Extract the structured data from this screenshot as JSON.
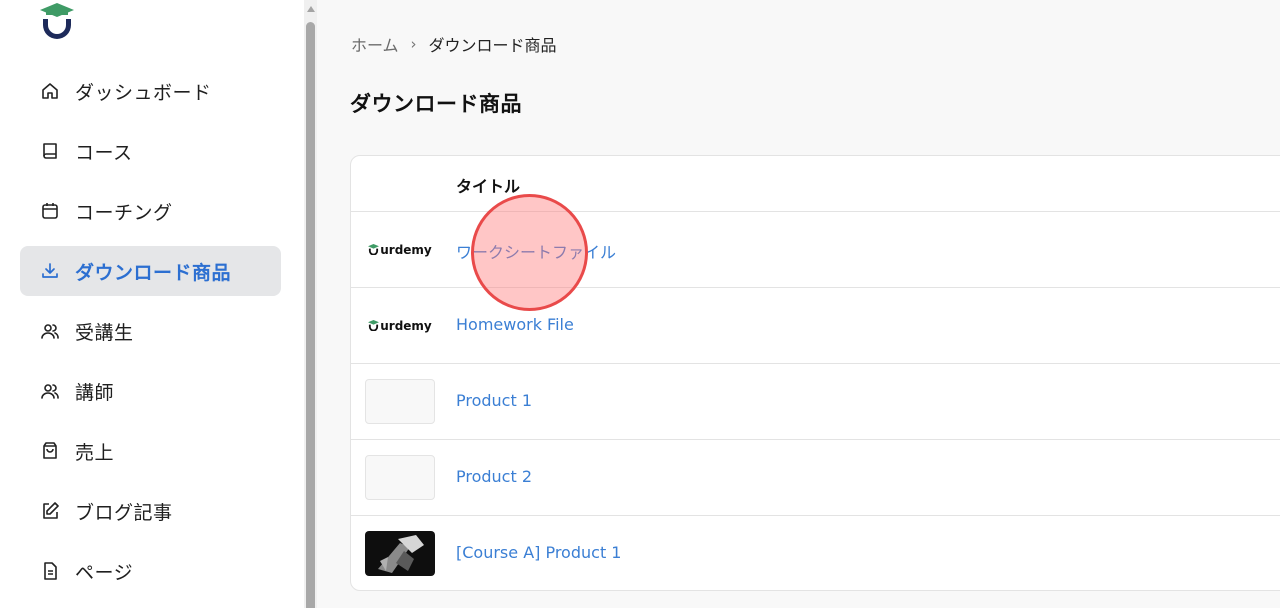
{
  "sidebar": {
    "items": [
      {
        "label": "ダッシュボード",
        "icon": "home-icon"
      },
      {
        "label": "コース",
        "icon": "book-icon"
      },
      {
        "label": "コーチング",
        "icon": "calendar-icon"
      },
      {
        "label": "ダウンロード商品",
        "icon": "download-icon",
        "active": true
      },
      {
        "label": "受講生",
        "icon": "users-icon"
      },
      {
        "label": "講師",
        "icon": "users-icon"
      },
      {
        "label": "売上",
        "icon": "shopping-bag-icon"
      },
      {
        "label": "ブログ記事",
        "icon": "edit-icon"
      },
      {
        "label": "ページ",
        "icon": "document-icon"
      }
    ]
  },
  "breadcrumb": {
    "home": "ホーム",
    "separator": "›",
    "current": "ダウンロード商品"
  },
  "page": {
    "title": "ダウンロード商品"
  },
  "table": {
    "header_title": "タイトル",
    "rows": [
      {
        "title": "ワークシートファイル",
        "thumb": "brand",
        "brand_text": "urdemy"
      },
      {
        "title": "Homework File",
        "thumb": "brand",
        "brand_text": "urdemy"
      },
      {
        "title": "Product 1",
        "thumb": "empty"
      },
      {
        "title": "Product 2",
        "thumb": "empty"
      },
      {
        "title": "[Course A] Product 1",
        "thumb": "image"
      }
    ]
  },
  "colors": {
    "accent": "#2c6fd1",
    "link": "#3b7fd4",
    "brand_green": "#3f9b66",
    "brand_navy": "#1d2a5a"
  }
}
